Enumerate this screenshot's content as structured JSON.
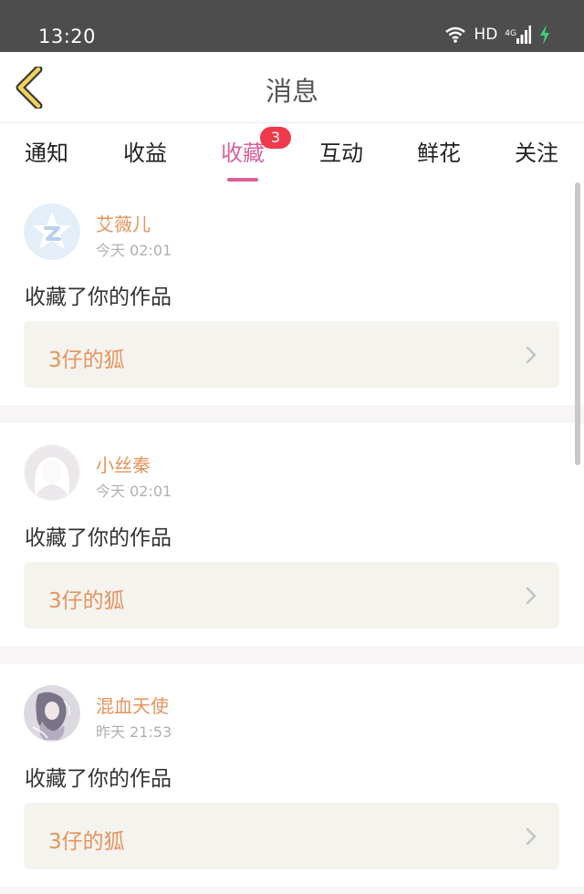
{
  "status_bar": {
    "time": "13:20",
    "network": "HD",
    "network_gen": "4G"
  },
  "header": {
    "title": "消息"
  },
  "tabs": [
    {
      "label": "通知",
      "active": false
    },
    {
      "label": "收益",
      "active": false
    },
    {
      "label": "收藏",
      "active": true,
      "badge": "3"
    },
    {
      "label": "互动",
      "active": false
    },
    {
      "label": "鲜花",
      "active": false
    },
    {
      "label": "关注",
      "active": false
    }
  ],
  "messages": [
    {
      "user": "艾薇儿",
      "time": "今天 02:01",
      "action": "收藏了你的作品",
      "work": "3仔的狐",
      "avatar": "qq-star-icon"
    },
    {
      "user": "小丝秦",
      "time": "今天 02:01",
      "action": "收藏了你的作品",
      "work": "3仔的狐",
      "avatar": "default-avatar-icon"
    },
    {
      "user": "混血天使",
      "time": "昨天 21:53",
      "action": "收藏了你的作品",
      "work": "3仔的狐",
      "avatar": "photo-avatar"
    }
  ],
  "colors": {
    "accent": "#d9619b",
    "username": "#e6945d",
    "badge": "#f0394a",
    "back_icon": "#f1d25a"
  }
}
